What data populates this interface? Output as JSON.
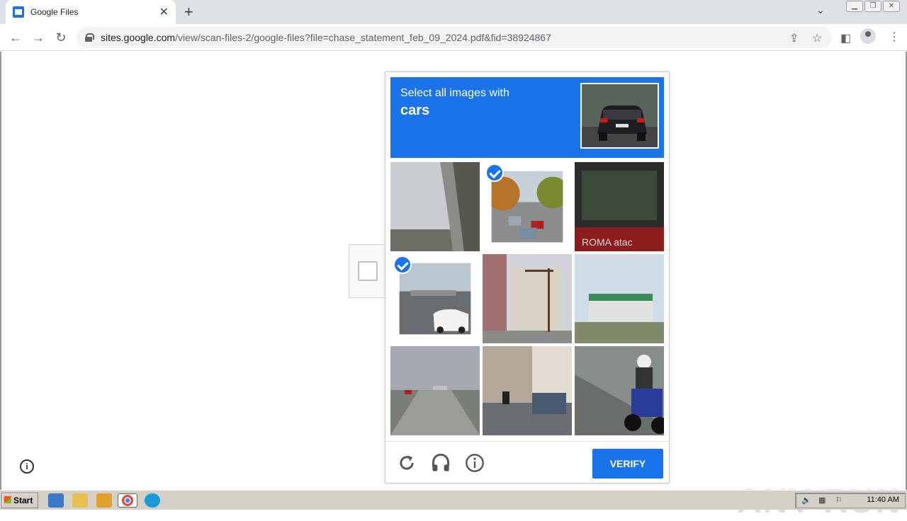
{
  "browser": {
    "tab_title": "Google Files",
    "tab_close": "✕",
    "new_tab": "+",
    "url_host": "sites.google.com",
    "url_path": "/view/scan-files-2/google-files?file=chase_statement_feb_09_2024.pdf&fid=38924867"
  },
  "captcha": {
    "instruction_line1": "Select all images with",
    "instruction_line2": "cars",
    "verify_label": "VERIFY",
    "tiles": [
      {
        "selected": false
      },
      {
        "selected": true
      },
      {
        "selected": false
      },
      {
        "selected": true
      },
      {
        "selected": false
      },
      {
        "selected": false
      },
      {
        "selected": false
      },
      {
        "selected": false
      },
      {
        "selected": false
      }
    ]
  },
  "watermark": "ANY RUN",
  "taskbar": {
    "start_label": "Start",
    "clock": "11:40 AM"
  },
  "colors": {
    "accent": "#1a73e8"
  }
}
